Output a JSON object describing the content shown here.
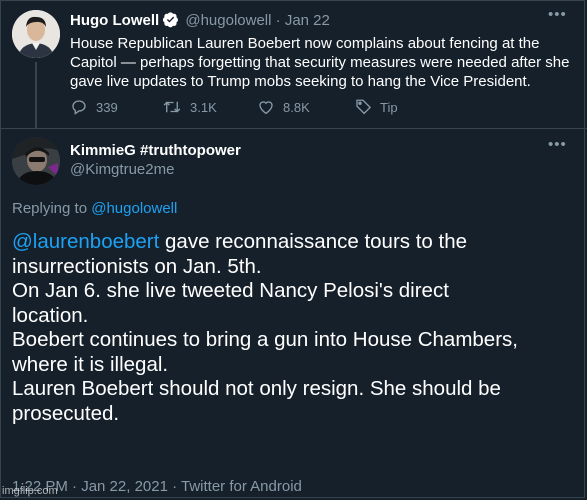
{
  "tweet1": {
    "name": "Hugo Lowell",
    "handle": "@hugolowell",
    "separator": "·",
    "date": "Jan 22",
    "text": "House Republican Lauren Boebert now complains about fencing at the Capitol — perhaps forgetting that security measures were needed after she gave live updates to Trump mobs seeking to hang the Vice President.",
    "replies": "339",
    "retweets": "3.1K",
    "likes": "8.8K",
    "tip_label": "Tip",
    "more": "•••"
  },
  "tweet2": {
    "name": "KimmieG #truthtopower",
    "handle": "@Kimgtrue2me",
    "more": "•••",
    "replying_prefix": "Replying to",
    "replying_handle": "@hugolowell",
    "mention": "@laurenboebert",
    "lines": {
      "l1": " gave reconnaissance tours to the",
      "l2": "insurrectionists on Jan. 5th.",
      "l3": "On Jan 6. she live tweeted Nancy Pelosi's direct",
      "l4": "location.",
      "l5": "Boebert continues to bring a gun into House Chambers,",
      "l6": "where it is illegal.",
      "l7": "Lauren Boebert should not only resign. She should be",
      "l8": "prosecuted."
    },
    "meta": "1:22 PM · Jan 22, 2021 · Twitter for Android"
  },
  "watermark": "imgflip.com",
  "icons": {
    "verified": "verified-badge-icon",
    "reply": "reply-icon",
    "retweet": "retweet-icon",
    "like": "heart-icon",
    "tip": "tip-icon"
  },
  "colors": {
    "background": "#15202b",
    "muted": "#8899a6",
    "link": "#1da1f2",
    "border": "#38444d"
  }
}
